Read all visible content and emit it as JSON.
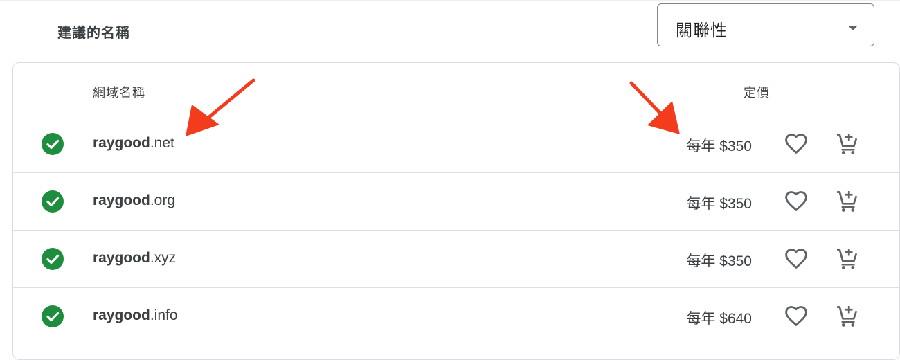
{
  "section_title": "建議的名稱",
  "sort": {
    "value": "關聯性"
  },
  "table": {
    "headers": {
      "domain": "網域名稱",
      "price": "定價"
    },
    "rows": [
      {
        "sld": "raygood",
        "tld": ".net",
        "price": "每年 $350"
      },
      {
        "sld": "raygood",
        "tld": ".org",
        "price": "每年 $350"
      },
      {
        "sld": "raygood",
        "tld": ".xyz",
        "price": "每年 $350"
      },
      {
        "sld": "raygood",
        "tld": ".info",
        "price": "每年 $640"
      }
    ]
  },
  "icons": {
    "available": "check-circle-icon",
    "favorite": "heart-outline-icon",
    "cart": "add-shopping-cart-icon",
    "annotation": "red-arrow"
  },
  "colors": {
    "available_green": "#1e8e3e",
    "icon_gray": "#5f6368",
    "annotation_red": "#f23c1d"
  }
}
